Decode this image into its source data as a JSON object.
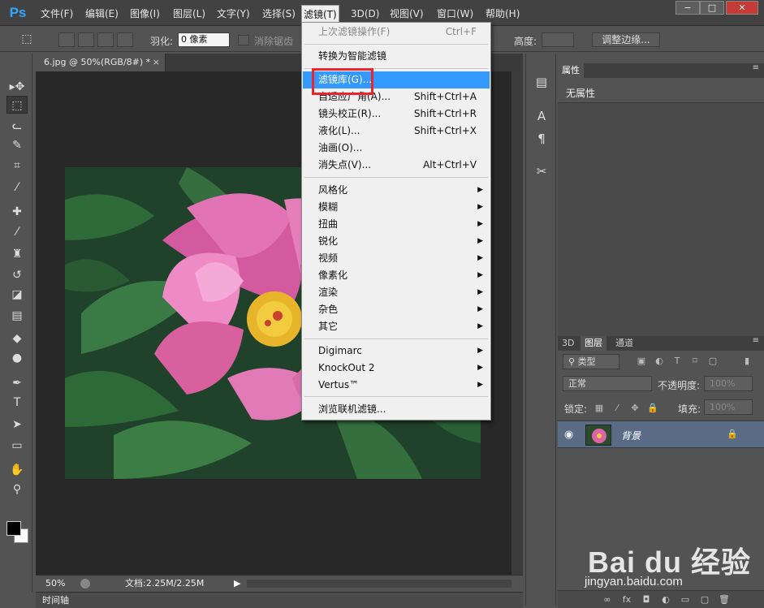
{
  "app": {
    "logo": "Ps"
  },
  "menubar": {
    "items": [
      "文件(F)",
      "编辑(E)",
      "图像(I)",
      "图层(L)",
      "文字(Y)",
      "选择(S)",
      "滤镜(T)",
      "3D(D)",
      "视图(V)",
      "窗口(W)",
      "帮助(H)"
    ],
    "open_index": 6
  },
  "window_controls": {
    "minimize": "−",
    "restore": "□",
    "close": "✕"
  },
  "options_bar": {
    "feather_label": "羽化:",
    "feather_value": "0 像素",
    "antialias_label": "消除锯齿",
    "height_label": "高度:",
    "refine_edge_button": "调整边缘..."
  },
  "tools": [
    {
      "icon": "move-icon",
      "glyph": "▸✥"
    },
    {
      "icon": "rect-marquee-icon",
      "glyph": "⬚"
    },
    {
      "icon": "lasso-icon",
      "glyph": "ᓚ"
    },
    {
      "icon": "quick-select-icon",
      "glyph": "✎"
    },
    {
      "icon": "crop-icon",
      "glyph": "⌗"
    },
    {
      "icon": "eyedropper-icon",
      "glyph": "⁄"
    },
    {
      "icon": "healing-brush-icon",
      "glyph": "✚"
    },
    {
      "icon": "brush-icon",
      "glyph": "⁄"
    },
    {
      "icon": "clone-stamp-icon",
      "glyph": "♜"
    },
    {
      "icon": "history-brush-icon",
      "glyph": "↺"
    },
    {
      "icon": "eraser-icon",
      "glyph": "◪"
    },
    {
      "icon": "gradient-icon",
      "glyph": "▤"
    },
    {
      "icon": "blur-icon",
      "glyph": "◆"
    },
    {
      "icon": "dodge-icon",
      "glyph": "●"
    },
    {
      "icon": "pen-icon",
      "glyph": "✒"
    },
    {
      "icon": "type-icon",
      "glyph": "T"
    },
    {
      "icon": "path-select-icon",
      "glyph": "➤"
    },
    {
      "icon": "shape-icon",
      "glyph": "▭"
    },
    {
      "icon": "hand-icon",
      "glyph": "✋"
    },
    {
      "icon": "zoom-icon",
      "glyph": "⚲"
    }
  ],
  "document": {
    "tab_title": "6.jpg @ 50%(RGB/8#) *",
    "tab_close": "×",
    "zoom": "50%",
    "doc_info": "文档:2.25M/2.25M",
    "timeline_label": "时间轴"
  },
  "filter_menu": {
    "items": [
      {
        "label": "上次滤镜操作(F)",
        "shortcut": "Ctrl+F",
        "disabled": true
      },
      {
        "label": "转换为智能滤镜"
      },
      {
        "label": "滤镜库(G)...",
        "highlighted": true
      },
      {
        "label": "自适应广角(A)...",
        "shortcut": "Shift+Ctrl+A"
      },
      {
        "label": "镜头校正(R)...",
        "shortcut": "Shift+Ctrl+R"
      },
      {
        "label": "液化(L)...",
        "shortcut": "Shift+Ctrl+X"
      },
      {
        "label": "油画(O)..."
      },
      {
        "label": "消失点(V)...",
        "shortcut": "Alt+Ctrl+V"
      },
      {
        "label": "风格化",
        "submenu": true
      },
      {
        "label": "模糊",
        "submenu": true
      },
      {
        "label": "扭曲",
        "submenu": true
      },
      {
        "label": "锐化",
        "submenu": true
      },
      {
        "label": "视频",
        "submenu": true
      },
      {
        "label": "像素化",
        "submenu": true
      },
      {
        "label": "渲染",
        "submenu": true
      },
      {
        "label": "杂色",
        "submenu": true
      },
      {
        "label": "其它",
        "submenu": true
      },
      {
        "label": "Digimarc",
        "submenu": true
      },
      {
        "label": "KnockOut 2",
        "submenu": true
      },
      {
        "label": "Vertus™",
        "submenu": true
      },
      {
        "label": "浏览联机滤镜..."
      }
    ]
  },
  "properties_panel": {
    "tab": "属性",
    "empty_label": "无属性"
  },
  "layers_panel": {
    "tabs": [
      "3D",
      "图层",
      "通道"
    ],
    "active_tab_index": 1,
    "filter_kind": "类型",
    "blend_mode": "正常",
    "opacity_label": "不透明度:",
    "opacity_value": "100%",
    "lock_label": "锁定:",
    "fill_label": "填充:",
    "fill_value": "100%",
    "layer_name": "背景"
  },
  "watermark": {
    "logo": "Bai du 经验",
    "url": "jingyan.baidu.com"
  },
  "colors": {
    "highlight": "#3399ff",
    "annotation": "#e8262e",
    "layer_selected": "#5a6b86",
    "ps_blue": "#31a8ff"
  }
}
